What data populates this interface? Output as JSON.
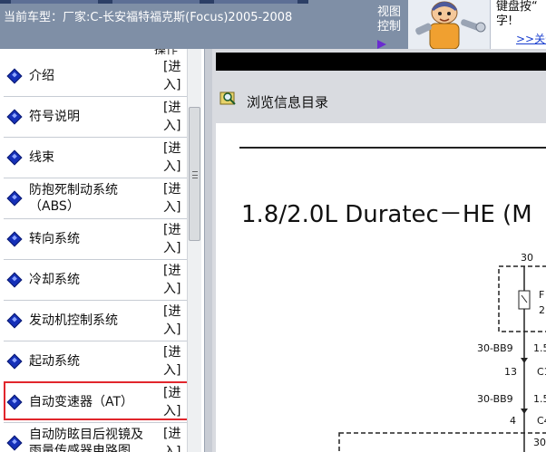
{
  "header": {
    "car_model": "当前车型：厂家:C-长安福特福克斯(Focus)2005-2008",
    "view_control": "视图控制",
    "tip_line1": "键盘按“",
    "tip_line2": "字!",
    "tip_link": ">>关于"
  },
  "menu": {
    "column_header": "操作",
    "enter_text": "[进入]",
    "items": [
      {
        "label": "介绍"
      },
      {
        "label": "符号说明"
      },
      {
        "label": "线束"
      },
      {
        "label": "防抱死制动系统",
        "label2": "（ABS）"
      },
      {
        "label": "转向系统"
      },
      {
        "label": "冷却系统"
      },
      {
        "label": "发动机控制系统"
      },
      {
        "label": "起动系统"
      },
      {
        "label": "自动变速器（AT）"
      },
      {
        "label": "自动防眩目后视镜及",
        "label2": "雨量传感器电路图"
      }
    ]
  },
  "viewer": {
    "browse_label": "浏览信息目录",
    "diagram_title": "1.8/2.0L Duratec－HE (M",
    "wire_labels": {
      "l30a": "30",
      "lf": "F",
      "l2": "2",
      "lbb1": "30-BB9",
      "l15a": "1.5",
      "l13": "13",
      "lc1": "C1",
      "lbb2": "30-BB9",
      "l15b": "1.5",
      "l4": "4",
      "lc4": "C4",
      "l30b": "30"
    }
  }
}
